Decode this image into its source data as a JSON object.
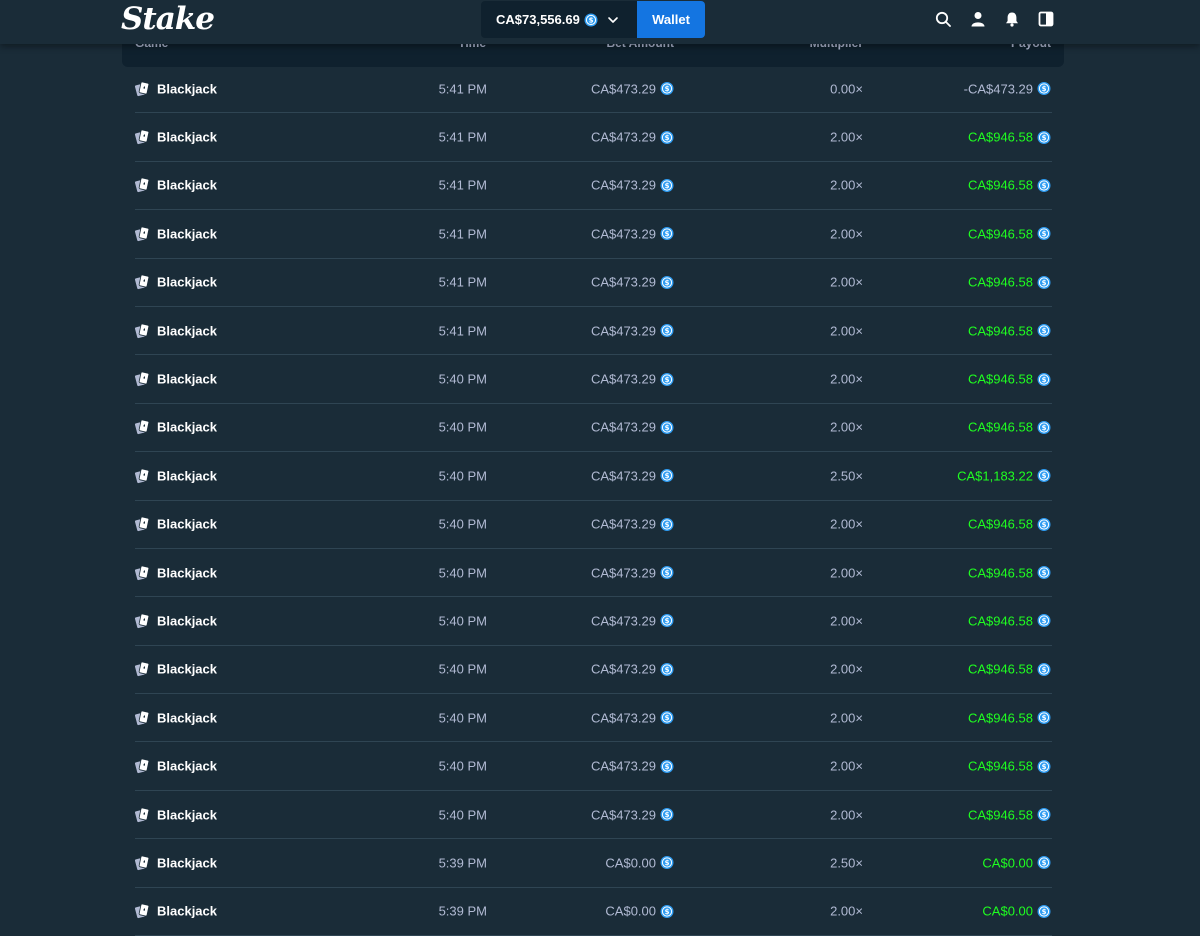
{
  "header": {
    "logo": "Stake",
    "balance": "CA$73,556.69",
    "wallet_label": "Wallet",
    "icons": [
      "search-icon",
      "user-icon",
      "bell-icon",
      "sidebar-toggle-icon"
    ]
  },
  "table": {
    "columns": [
      "Game",
      "Time",
      "Bet Amount",
      "Multiplier",
      "Payout"
    ],
    "rows": [
      {
        "game": "Blackjack",
        "time": "5:41 PM",
        "bet": "CA$473.29",
        "mult": "0.00×",
        "payout": "-CA$473.29",
        "win": false
      },
      {
        "game": "Blackjack",
        "time": "5:41 PM",
        "bet": "CA$473.29",
        "mult": "2.00×",
        "payout": "CA$946.58",
        "win": true
      },
      {
        "game": "Blackjack",
        "time": "5:41 PM",
        "bet": "CA$473.29",
        "mult": "2.00×",
        "payout": "CA$946.58",
        "win": true
      },
      {
        "game": "Blackjack",
        "time": "5:41 PM",
        "bet": "CA$473.29",
        "mult": "2.00×",
        "payout": "CA$946.58",
        "win": true
      },
      {
        "game": "Blackjack",
        "time": "5:41 PM",
        "bet": "CA$473.29",
        "mult": "2.00×",
        "payout": "CA$946.58",
        "win": true
      },
      {
        "game": "Blackjack",
        "time": "5:41 PM",
        "bet": "CA$473.29",
        "mult": "2.00×",
        "payout": "CA$946.58",
        "win": true
      },
      {
        "game": "Blackjack",
        "time": "5:40 PM",
        "bet": "CA$473.29",
        "mult": "2.00×",
        "payout": "CA$946.58",
        "win": true
      },
      {
        "game": "Blackjack",
        "time": "5:40 PM",
        "bet": "CA$473.29",
        "mult": "2.00×",
        "payout": "CA$946.58",
        "win": true
      },
      {
        "game": "Blackjack",
        "time": "5:40 PM",
        "bet": "CA$473.29",
        "mult": "2.50×",
        "payout": "CA$1,183.22",
        "win": true
      },
      {
        "game": "Blackjack",
        "time": "5:40 PM",
        "bet": "CA$473.29",
        "mult": "2.00×",
        "payout": "CA$946.58",
        "win": true
      },
      {
        "game": "Blackjack",
        "time": "5:40 PM",
        "bet": "CA$473.29",
        "mult": "2.00×",
        "payout": "CA$946.58",
        "win": true
      },
      {
        "game": "Blackjack",
        "time": "5:40 PM",
        "bet": "CA$473.29",
        "mult": "2.00×",
        "payout": "CA$946.58",
        "win": true
      },
      {
        "game": "Blackjack",
        "time": "5:40 PM",
        "bet": "CA$473.29",
        "mult": "2.00×",
        "payout": "CA$946.58",
        "win": true
      },
      {
        "game": "Blackjack",
        "time": "5:40 PM",
        "bet": "CA$473.29",
        "mult": "2.00×",
        "payout": "CA$946.58",
        "win": true
      },
      {
        "game": "Blackjack",
        "time": "5:40 PM",
        "bet": "CA$473.29",
        "mult": "2.00×",
        "payout": "CA$946.58",
        "win": true
      },
      {
        "game": "Blackjack",
        "time": "5:40 PM",
        "bet": "CA$473.29",
        "mult": "2.00×",
        "payout": "CA$946.58",
        "win": true
      },
      {
        "game": "Blackjack",
        "time": "5:39 PM",
        "bet": "CA$0.00",
        "mult": "2.50×",
        "payout": "CA$0.00",
        "win": true
      },
      {
        "game": "Blackjack",
        "time": "5:39 PM",
        "bet": "CA$0.00",
        "mult": "2.00×",
        "payout": "CA$0.00",
        "win": true
      }
    ]
  },
  "colors": {
    "background": "#1a2c38",
    "panel": "#0f212e",
    "accent": "#1475e1",
    "win": "#1fff20",
    "coin": "#2e9cf2"
  }
}
